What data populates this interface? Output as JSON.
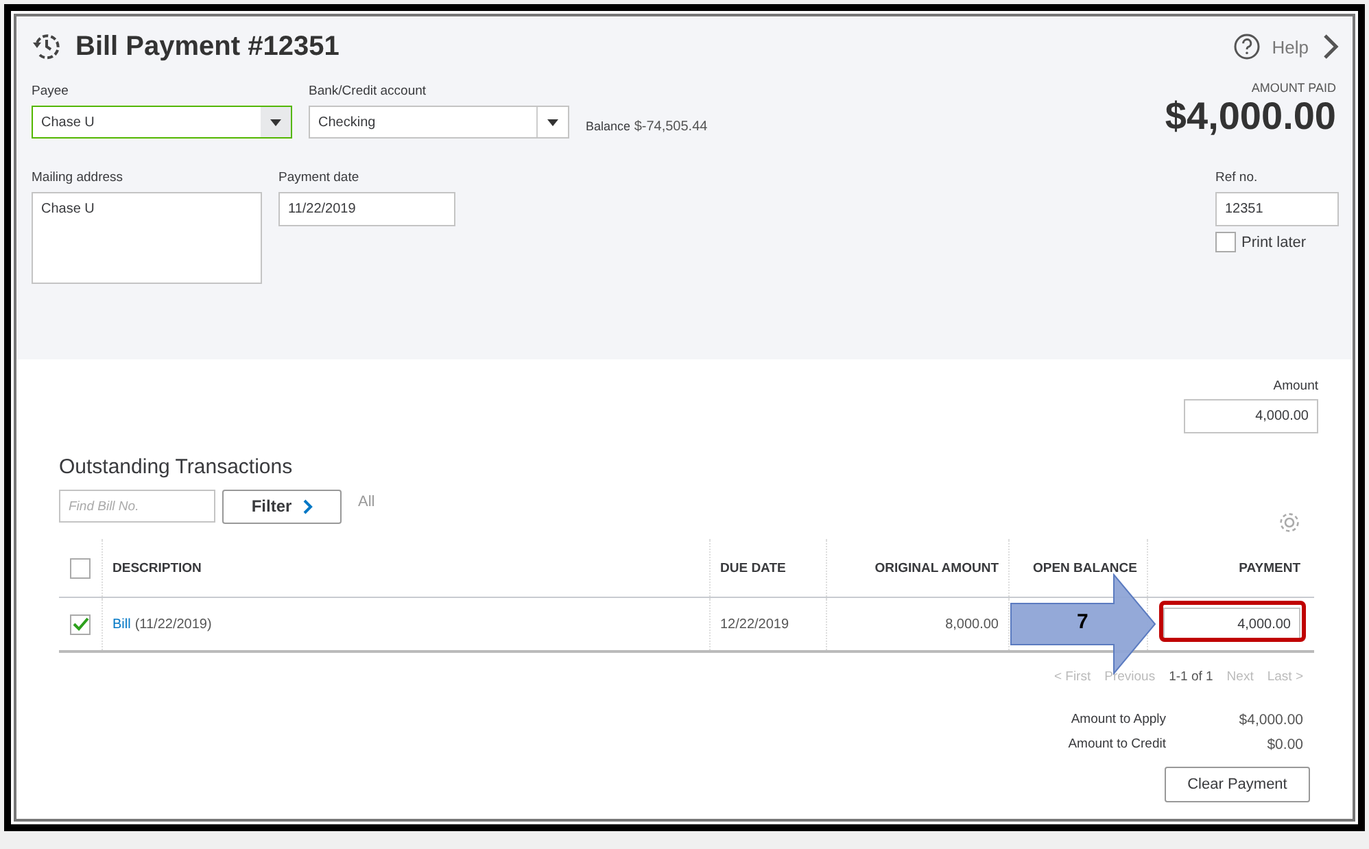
{
  "header": {
    "title": "Bill Payment #12351",
    "help": "Help"
  },
  "payee": {
    "label": "Payee",
    "value": "Chase U"
  },
  "bank_account": {
    "label": "Bank/Credit account",
    "value": "Checking"
  },
  "balance": {
    "label": "Balance",
    "value": "$-74,505.44"
  },
  "amount_paid": {
    "label": "AMOUNT PAID",
    "value": "$4,000.00"
  },
  "mailing_address": {
    "label": "Mailing address",
    "value": "Chase U"
  },
  "payment_date": {
    "label": "Payment date",
    "value": "11/22/2019"
  },
  "ref_no": {
    "label": "Ref no.",
    "value": "12351"
  },
  "print_later": {
    "label": "Print later",
    "checked": false
  },
  "amount": {
    "label": "Amount",
    "value": "4,000.00"
  },
  "outstanding": {
    "title": "Outstanding Transactions",
    "search": {
      "placeholder": "Find Bill No."
    },
    "filter": "Filter",
    "filter_status": "All",
    "columns": [
      "DESCRIPTION",
      "DUE DATE",
      "ORIGINAL AMOUNT",
      "OPEN BALANCE",
      "PAYMENT"
    ],
    "select_all": {
      "checked": false
    },
    "rows": [
      {
        "checked": true,
        "link": "Bill",
        "description": "(11/22/2019)",
        "due_date": "12/22/2019",
        "original_amount": "8,000.00",
        "payment": "4,000.00"
      }
    ],
    "pagination": {
      "first": "< First",
      "previous": "Previous",
      "range": "1-1 of 1",
      "next": "Next",
      "last": "Last >"
    }
  },
  "summary": [
    {
      "label": "Amount to Apply",
      "value": "$4,000.00"
    },
    {
      "label": "Amount to Credit",
      "value": "$0.00"
    }
  ],
  "clear_button": "Clear Payment",
  "annotation": {
    "label": "7"
  }
}
